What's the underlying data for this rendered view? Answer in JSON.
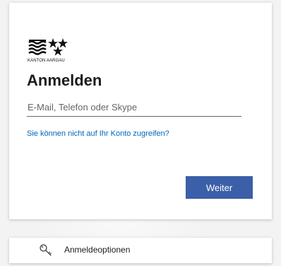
{
  "brand": {
    "logo_text": "KANTON AARGAU",
    "logo_icon": "kanton-aargau-coat-of-arms"
  },
  "signin": {
    "title": "Anmelden",
    "email_placeholder": "E-Mail, Telefon oder Skype",
    "email_value": "",
    "cant_access_link": "Sie können nicht auf Ihr Konto zugreifen?",
    "next_button": "Weiter"
  },
  "options": {
    "label": "Anmeldeoptionen",
    "icon": "key-icon"
  },
  "colors": {
    "accent": "#3b5fa8",
    "link": "#0067b8"
  }
}
